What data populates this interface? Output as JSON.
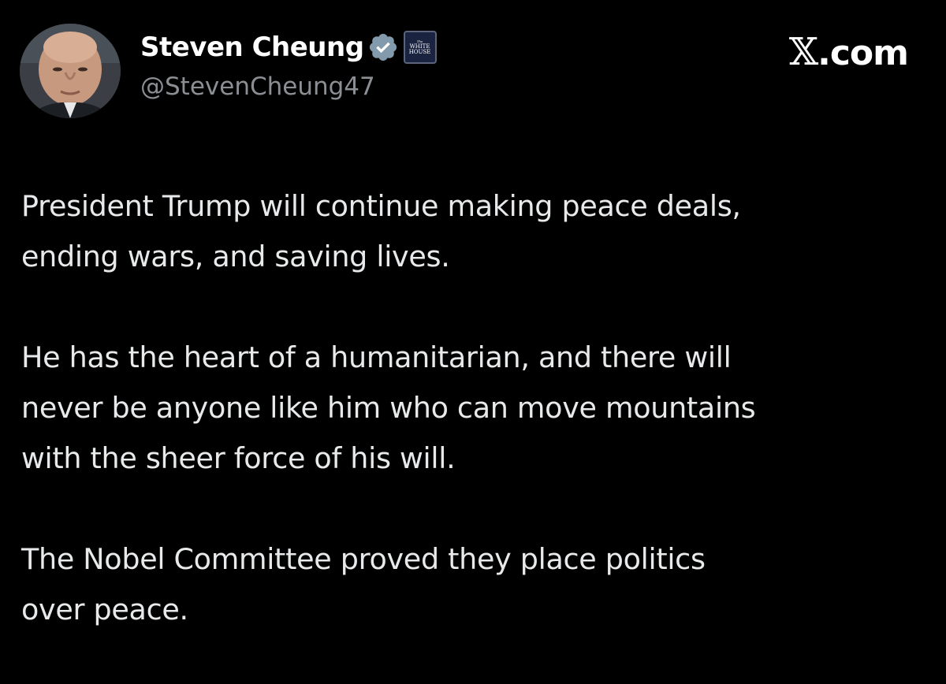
{
  "author": {
    "display_name": "Steven Cheung",
    "handle": "@StevenCheung47",
    "avatar_icon": "profile-photo",
    "verified_icon": "verified-badge-icon",
    "affiliate_badge": {
      "icon": "white-house-logo-icon",
      "line1": "The",
      "line2": "WHITE",
      "line3": "HOUSE"
    }
  },
  "brand": {
    "label": "X.com",
    "x_glyph": "𝕏",
    "suffix": ".com"
  },
  "post": {
    "paragraphs": [
      "President Trump will continue making peace deals,\nending wars, and saving lives.",
      "He has the heart of a humanitarian, and there will\nnever be anyone like him who can move mountains\nwith the sheer force of his will.",
      "The Nobel Committee proved they place politics\nover peace."
    ]
  },
  "colors": {
    "background": "#000000",
    "text_primary": "#e7e9ea",
    "text_secondary": "#8b8f94",
    "verified_gray": "#829aab"
  }
}
